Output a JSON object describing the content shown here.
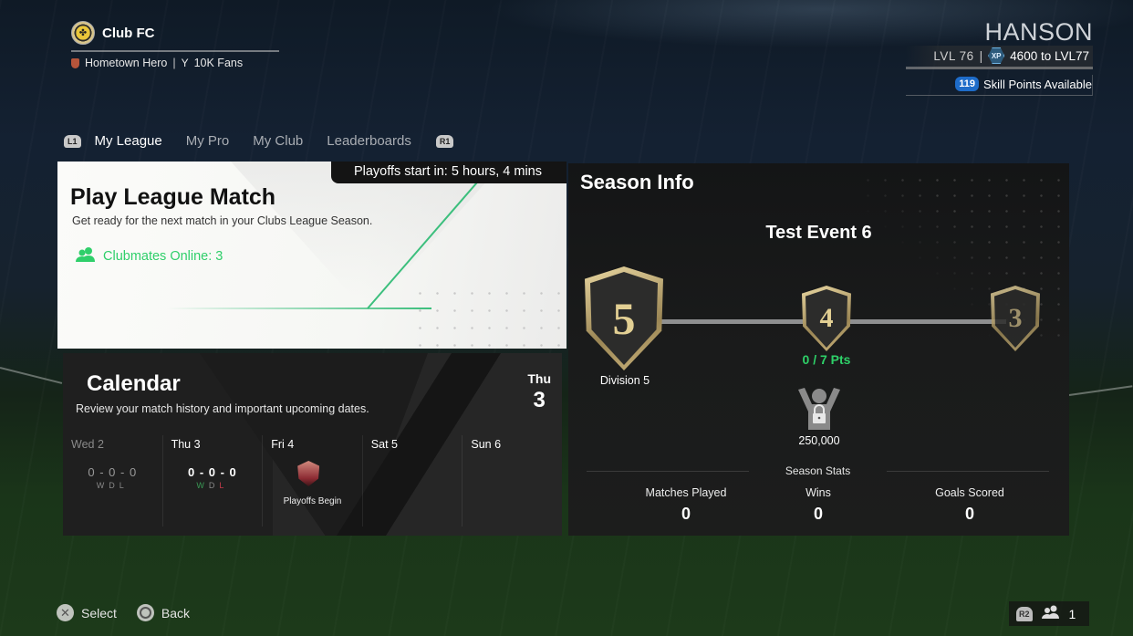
{
  "club": {
    "name": "Club FC",
    "badge": "Hometown Hero",
    "fans": "10K Fans"
  },
  "player": {
    "name": "HANSON",
    "level": "LVL 76",
    "xp_icon": "XP",
    "xp_to_next": "4600 to LVL77",
    "skill_points": "119",
    "skill_points_label": "Skill Points Available"
  },
  "tabs": {
    "left_button": "L1",
    "right_button": "R1",
    "items": [
      {
        "label": "My League",
        "active": true
      },
      {
        "label": "My Pro",
        "active": false
      },
      {
        "label": "My Club",
        "active": false
      },
      {
        "label": "Leaderboards",
        "active": false
      }
    ]
  },
  "play_card": {
    "timer_label": "Playoffs start in:  5 hours, 4 mins",
    "title": "Play League Match",
    "description": "Get ready for the next match in your Clubs League Season.",
    "clubmates": "Clubmates Online: 3",
    "accent_color": "#2fcf6a"
  },
  "calendar": {
    "title": "Calendar",
    "description": "Review your match history and important upcoming dates.",
    "today_day": "Thu",
    "today_num": "3",
    "days": [
      {
        "label": "Wed 2",
        "score": "0 - 0 - 0",
        "wdl": [
          "W",
          "D",
          "L"
        ]
      },
      {
        "label": "Thu 3",
        "score": "0 - 0 - 0",
        "wdl": [
          "W",
          "D",
          "L"
        ]
      },
      {
        "label": "Fri 4",
        "event": "Playoffs Begin"
      },
      {
        "label": "Sat 5"
      },
      {
        "label": "Sun 6"
      }
    ]
  },
  "season": {
    "title": "Season Info",
    "event_name": "Test Event 6",
    "divisions": [
      "5",
      "4",
      "3"
    ],
    "current_division_label": "Division 5",
    "points": "0 / 7 Pts",
    "fan_reward": "250,000",
    "stats_header": "Season Stats",
    "stats": [
      {
        "label": "Matches Played",
        "value": "0"
      },
      {
        "label": "Wins",
        "value": "0"
      },
      {
        "label": "Goals Scored",
        "value": "0"
      }
    ]
  },
  "footer": {
    "select_label": "Select",
    "back_label": "Back",
    "party_button": "R2",
    "party_count": "1"
  }
}
